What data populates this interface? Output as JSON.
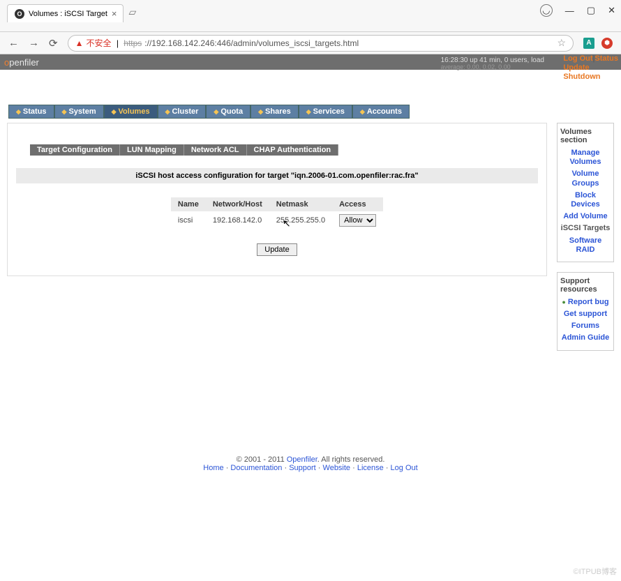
{
  "browser": {
    "tab_title": "Volumes : iSCSI Target",
    "insecure_label": "不安全",
    "url_proto": "https",
    "url_rest": "://192.168.142.246:446/admin/volumes_iscsi_targets.html"
  },
  "window": {
    "user_icon": "◯",
    "minimize": "—",
    "maximize": "▢",
    "close": "✕"
  },
  "header": {
    "logo": "openfiler",
    "uptime": "16:28:30 up 41 min, 0 users, load",
    "uptime2": "average: 0.00, 0.02, 0.00",
    "links": [
      "Log Out",
      "Status",
      "Update",
      "Shutdown"
    ]
  },
  "nav": {
    "items": [
      "Status",
      "System",
      "Volumes",
      "Cluster",
      "Quota",
      "Shares",
      "Services",
      "Accounts"
    ],
    "active_index": 2
  },
  "subtabs": [
    "Target Configuration",
    "LUN Mapping",
    "Network ACL",
    "CHAP Authentication"
  ],
  "config": {
    "title": "iSCSI host access configuration for target \"iqn.2006-01.com.openfiler:rac.fra\"",
    "headers": [
      "Name",
      "Network/Host",
      "Netmask",
      "Access"
    ],
    "row": {
      "name": "iscsi",
      "host": "192.168.142.0",
      "netmask": "255.255.255.0",
      "access": "Allow"
    },
    "update_label": "Update"
  },
  "sidebar": {
    "volumes_title": "Volumes section",
    "volumes_links": [
      "Manage Volumes",
      "Volume Groups",
      "Block Devices",
      "Add Volume",
      "iSCSI Targets",
      "Software RAID"
    ],
    "support_title": "Support resources",
    "support_links": [
      "Report bug",
      "Get support",
      "Forums",
      "Admin Guide"
    ]
  },
  "footer": {
    "copyright_pre": "© 2001 - 2011 ",
    "openfiler": "Openfiler",
    "copyright_post": ". All rights reserved.",
    "links": [
      "Home",
      "Documentation",
      "Support",
      "Website",
      "License",
      "Log Out"
    ]
  },
  "watermark": "©ITPUB博客"
}
